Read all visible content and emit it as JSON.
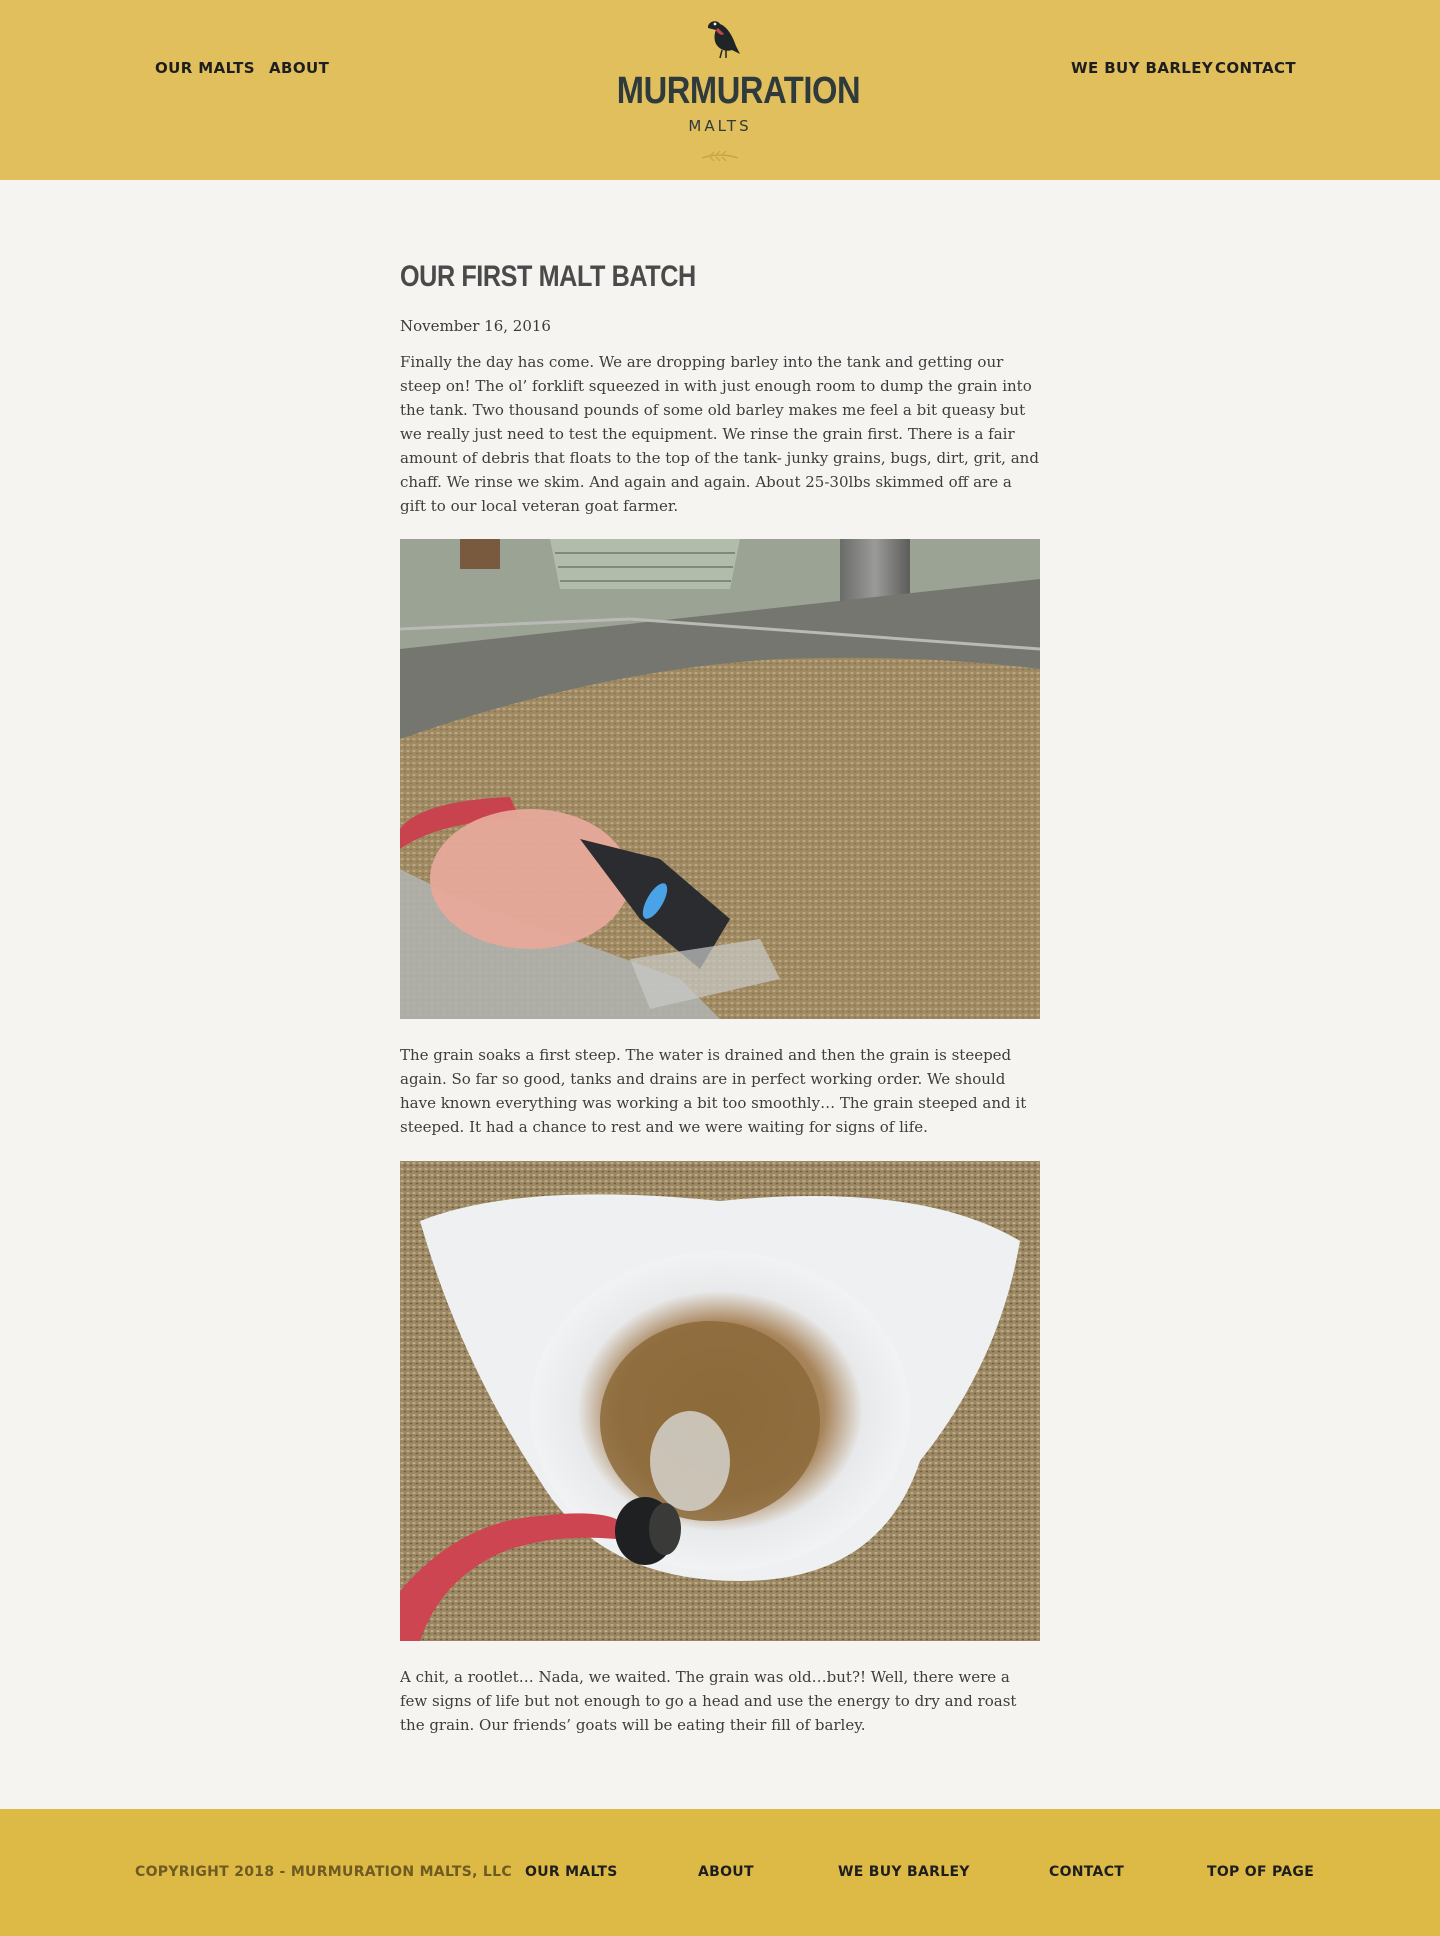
{
  "header": {
    "nav_left": [
      "OUR MALTS",
      "ABOUT"
    ],
    "nav_right": [
      "WE BUY BARLEY",
      "CONTACT"
    ],
    "logo": {
      "name": "MURMURATION",
      "sub": "MALTS"
    }
  },
  "post": {
    "title": "OUR FIRST MALT BATCH",
    "date": "November 16, 2016",
    "paragraphs": [
      "Finally the day has come. We are dropping barley into the tank and getting our steep on! The ol’ forklift squeezed in with just enough room to dump the grain into the tank.  Two thousand pounds of some old barley makes me feel a bit queasy but we really just need to test the equipment. We rinse the grain first. There is a fair amount of debris that floats to the top of the tank- junky grains, bugs, dirt, grit, and chaff. We rinse we skim. And again and again. About 25-30lbs skimmed off are a gift to our local veteran goat farmer.",
      "The grain soaks a first steep. The water is drained and then the grain is steeped again. So far so good, tanks and drains are in perfect working order. We should have known everything was working a bit too smoothly… The grain steeped and it steeped. It had a chance to rest and we were waiting for signs of life.",
      "A chit, a rootlet… Nada, we waited. The grain was old…but?! Well, there were a few signs of life but not enough to go a head and use the energy to dry and roast the grain. Our friends’ goats will be eating their fill of barley."
    ]
  },
  "footer": {
    "copyright": "COPYRIGHT 2018 - MURMURATION MALTS, LLC",
    "links": [
      "OUR MALTS",
      "ABOUT",
      "WE BUY BARLEY",
      "CONTACT",
      "TOP OF PAGE"
    ]
  },
  "colors": {
    "header_bg": "#e0bf5c",
    "footer_bg": "#ddb946",
    "page_bg": "#f5f4f1",
    "hose_red": "#c8434e"
  }
}
